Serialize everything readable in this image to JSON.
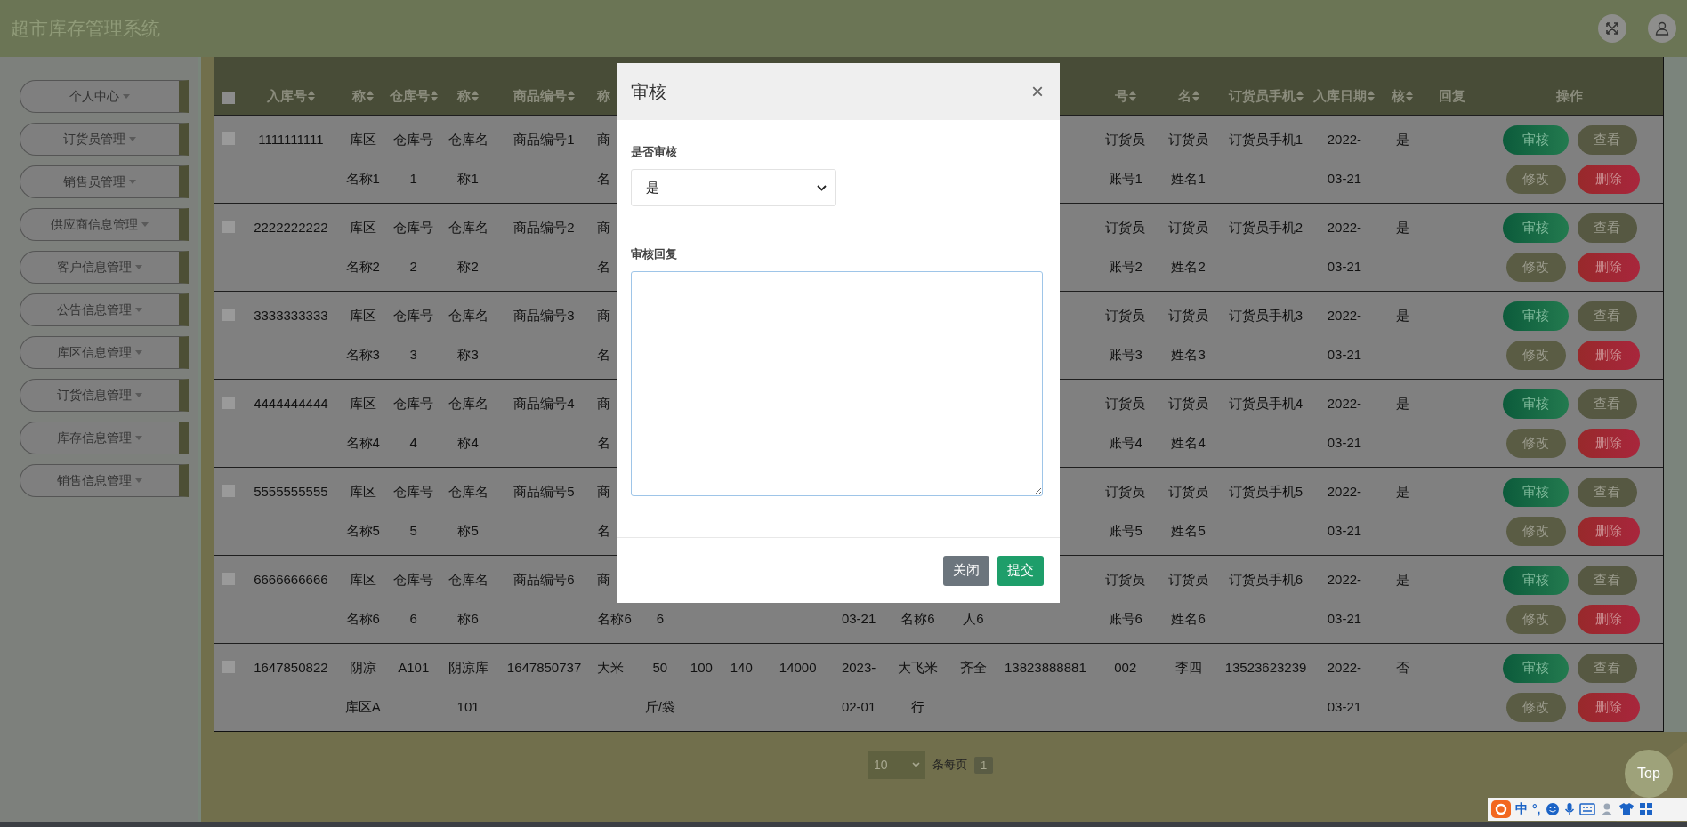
{
  "app": {
    "title": "超市库存管理系统"
  },
  "sidebar": {
    "items": [
      {
        "label": "个人中心"
      },
      {
        "label": "订货员管理"
      },
      {
        "label": "销售员管理"
      },
      {
        "label": "供应商信息管理"
      },
      {
        "label": "客户信息管理"
      },
      {
        "label": "公告信息管理"
      },
      {
        "label": "库区信息管理"
      },
      {
        "label": "订货信息管理"
      },
      {
        "label": "库存信息管理"
      },
      {
        "label": "销售信息管理"
      }
    ]
  },
  "table": {
    "select_all_checked": false,
    "columns": [
      {
        "label": "入库号",
        "sortable": true
      },
      {
        "label": "称",
        "sortable": true
      },
      {
        "label": "仓库号",
        "sortable": true
      },
      {
        "label": "称",
        "sortable": true
      },
      {
        "label": "商品编号",
        "sortable": true
      },
      {
        "label": "称",
        "sortable": false
      },
      null,
      null,
      null,
      null,
      null,
      null,
      null,
      null,
      {
        "label": "号",
        "sortable": true
      },
      {
        "label": "名",
        "sortable": true
      },
      {
        "label": "订货员手机",
        "sortable": true
      },
      {
        "label": "入库日期",
        "sortable": true
      },
      {
        "label": "核",
        "sortable": true
      },
      {
        "label": "回复",
        "sortable": false
      },
      {
        "label": "操作",
        "sortable": false
      }
    ],
    "rows": [
      {
        "checked": false,
        "cells": [
          [
            "1111111111"
          ],
          [
            "库区",
            "名称1"
          ],
          [
            "仓库号",
            "1"
          ],
          [
            "仓库名",
            "称1"
          ],
          [
            "商品编号1"
          ],
          [
            "商",
            "名"
          ],
          null,
          null,
          null,
          null,
          null,
          null,
          null,
          null,
          [
            "订货员",
            "账号1"
          ],
          [
            "订货员",
            "姓名1"
          ],
          [
            "订货员手机1"
          ],
          [
            "2022-",
            "03-21"
          ],
          [
            "是"
          ],
          null
        ],
        "actions": [
          {
            "label": "审核",
            "kind": "review"
          },
          {
            "label": "查看",
            "kind": "view"
          },
          {
            "label": "修改",
            "kind": "edit"
          },
          {
            "label": "删除",
            "kind": "delete"
          }
        ]
      },
      {
        "checked": false,
        "cells": [
          [
            "2222222222"
          ],
          [
            "库区",
            "名称2"
          ],
          [
            "仓库号",
            "2"
          ],
          [
            "仓库名",
            "称2"
          ],
          [
            "商品编号2"
          ],
          [
            "商",
            "名"
          ],
          null,
          null,
          null,
          null,
          null,
          null,
          null,
          null,
          [
            "订货员",
            "账号2"
          ],
          [
            "订货员",
            "姓名2"
          ],
          [
            "订货员手机2"
          ],
          [
            "2022-",
            "03-21"
          ],
          [
            "是"
          ],
          null
        ],
        "actions": [
          {
            "label": "审核",
            "kind": "review"
          },
          {
            "label": "查看",
            "kind": "view"
          },
          {
            "label": "修改",
            "kind": "edit"
          },
          {
            "label": "删除",
            "kind": "delete"
          }
        ]
      },
      {
        "checked": false,
        "cells": [
          [
            "3333333333"
          ],
          [
            "库区",
            "名称3"
          ],
          [
            "仓库号",
            "3"
          ],
          [
            "仓库名",
            "称3"
          ],
          [
            "商品编号3"
          ],
          [
            "商",
            "名"
          ],
          null,
          null,
          null,
          null,
          null,
          null,
          null,
          null,
          [
            "订货员",
            "账号3"
          ],
          [
            "订货员",
            "姓名3"
          ],
          [
            "订货员手机3"
          ],
          [
            "2022-",
            "03-21"
          ],
          [
            "是"
          ],
          null
        ],
        "actions": [
          {
            "label": "审核",
            "kind": "review"
          },
          {
            "label": "查看",
            "kind": "view"
          },
          {
            "label": "修改",
            "kind": "edit"
          },
          {
            "label": "删除",
            "kind": "delete"
          }
        ]
      },
      {
        "checked": false,
        "cells": [
          [
            "4444444444"
          ],
          [
            "库区",
            "名称4"
          ],
          [
            "仓库号",
            "4"
          ],
          [
            "仓库名",
            "称4"
          ],
          [
            "商品编号4"
          ],
          [
            "商",
            "名"
          ],
          null,
          null,
          null,
          null,
          null,
          null,
          null,
          null,
          [
            "订货员",
            "账号4"
          ],
          [
            "订货员",
            "姓名4"
          ],
          [
            "订货员手机4"
          ],
          [
            "2022-",
            "03-21"
          ],
          [
            "是"
          ],
          null
        ],
        "actions": [
          {
            "label": "审核",
            "kind": "review"
          },
          {
            "label": "查看",
            "kind": "view"
          },
          {
            "label": "修改",
            "kind": "edit"
          },
          {
            "label": "删除",
            "kind": "delete"
          }
        ]
      },
      {
        "checked": false,
        "cells": [
          [
            "5555555555"
          ],
          [
            "库区",
            "名称5"
          ],
          [
            "仓库号",
            "5"
          ],
          [
            "仓库名",
            "称5"
          ],
          [
            "商品编号5"
          ],
          [
            "商",
            "名"
          ],
          null,
          null,
          null,
          null,
          null,
          null,
          null,
          null,
          [
            "订货员",
            "账号5"
          ],
          [
            "订货员",
            "姓名5"
          ],
          [
            "订货员手机5"
          ],
          [
            "2022-",
            "03-21"
          ],
          [
            "是"
          ],
          null
        ],
        "actions": [
          {
            "label": "审核",
            "kind": "review"
          },
          {
            "label": "查看",
            "kind": "view"
          },
          {
            "label": "修改",
            "kind": "edit"
          },
          {
            "label": "删除",
            "kind": "delete"
          }
        ]
      },
      {
        "checked": false,
        "cells": [
          [
            "6666666666"
          ],
          [
            "库区",
            "名称6"
          ],
          [
            "仓库号",
            "6"
          ],
          [
            "仓库名",
            "称6"
          ],
          [
            "商品编号6"
          ],
          [
            "商",
            "名称6"
          ],
          [
            null,
            "6"
          ],
          null,
          null,
          null,
          [
            null,
            "03-21"
          ],
          [
            null,
            "名称6"
          ],
          [
            null,
            "人6"
          ],
          null,
          [
            "订货员",
            "账号6"
          ],
          [
            "订货员",
            "姓名6"
          ],
          [
            "订货员手机6"
          ],
          [
            "2022-",
            "03-21"
          ],
          [
            "是"
          ],
          null
        ],
        "actions": [
          {
            "label": "审核",
            "kind": "review"
          },
          {
            "label": "查看",
            "kind": "view"
          },
          {
            "label": "修改",
            "kind": "edit"
          },
          {
            "label": "删除",
            "kind": "delete"
          }
        ]
      },
      {
        "checked": false,
        "cells": [
          [
            "1647850822"
          ],
          [
            "阴凉",
            "库区A"
          ],
          [
            "A101"
          ],
          [
            "阴凉库",
            "101"
          ],
          [
            "1647850737"
          ],
          [
            "大米"
          ],
          [
            "50",
            "斤/袋"
          ],
          [
            "100"
          ],
          [
            "140"
          ],
          [
            "14000"
          ],
          [
            "2023-",
            "02-01"
          ],
          [
            "大飞米",
            "行"
          ],
          [
            "齐全"
          ],
          [
            "13823888881"
          ],
          [
            "002"
          ],
          [
            "李四"
          ],
          [
            "13523623239"
          ],
          [
            "2022-",
            "03-21"
          ],
          [
            "否"
          ],
          null
        ],
        "actions": [
          {
            "label": "审核",
            "kind": "review"
          },
          {
            "label": "查看",
            "kind": "view"
          },
          {
            "label": "修改",
            "kind": "edit"
          },
          {
            "label": "删除",
            "kind": "delete"
          }
        ]
      }
    ]
  },
  "pagination": {
    "page_size": "10",
    "label": "条每页",
    "page": "1"
  },
  "modal": {
    "title": "审核",
    "close": "×",
    "fields": [
      {
        "kind": "select",
        "label": "是否审核",
        "value": "是"
      },
      {
        "kind": "textarea",
        "label": "审核回复"
      }
    ],
    "buttons": [
      {
        "label": "关闭",
        "kind": "secondary"
      },
      {
        "label": "提交",
        "kind": "primary"
      }
    ]
  },
  "top_button": "Top",
  "ime_toolbar": {
    "items": [
      "中",
      "°,"
    ]
  }
}
